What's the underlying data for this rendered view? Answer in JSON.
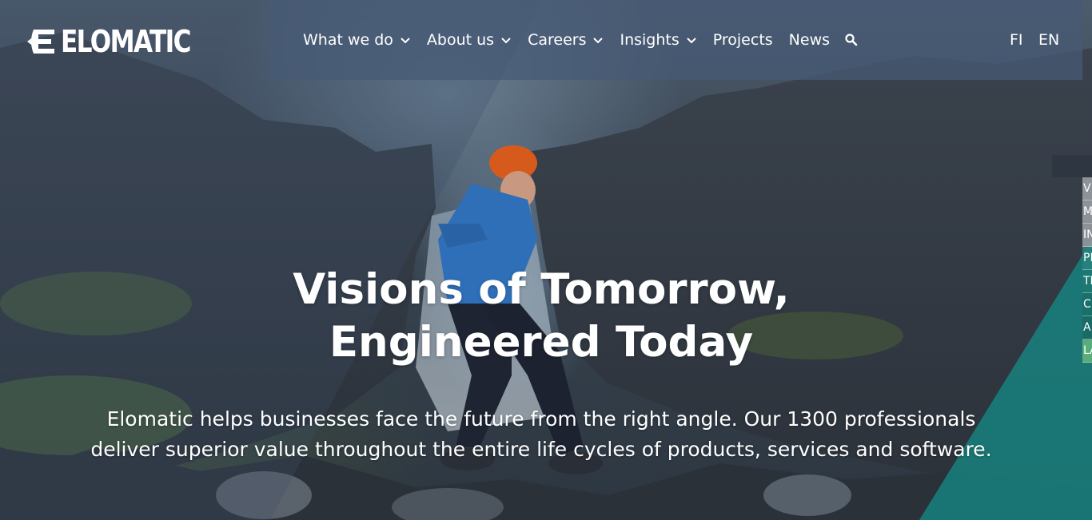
{
  "brand": {
    "name": "ELOMATIC"
  },
  "nav": {
    "items": [
      {
        "label": "What we do",
        "has_dropdown": true
      },
      {
        "label": "About us",
        "has_dropdown": true
      },
      {
        "label": "Careers",
        "has_dropdown": true
      },
      {
        "label": "Insights",
        "has_dropdown": true
      },
      {
        "label": "Projects",
        "has_dropdown": false
      },
      {
        "label": "News",
        "has_dropdown": false
      }
    ],
    "search_icon": "search-icon"
  },
  "languages": [
    "FI",
    "EN"
  ],
  "hero": {
    "title_line1": "Visions of Tomorrow,",
    "title_line2": "Engineered Today",
    "subtitle": "Elomatic helps businesses face the future from the right angle. Our 1300 professionals deliver superior value throughout the entire life cycles of products, services and software."
  },
  "side_menu": {
    "items": [
      "V",
      "M",
      "IN",
      "PI",
      "TE",
      "C",
      "A",
      "LA"
    ]
  },
  "colors": {
    "nav_overlay": "#46597a",
    "accent_teal": "#1a8a86",
    "accent_green": "#5cb07a",
    "text": "#ffffff"
  }
}
